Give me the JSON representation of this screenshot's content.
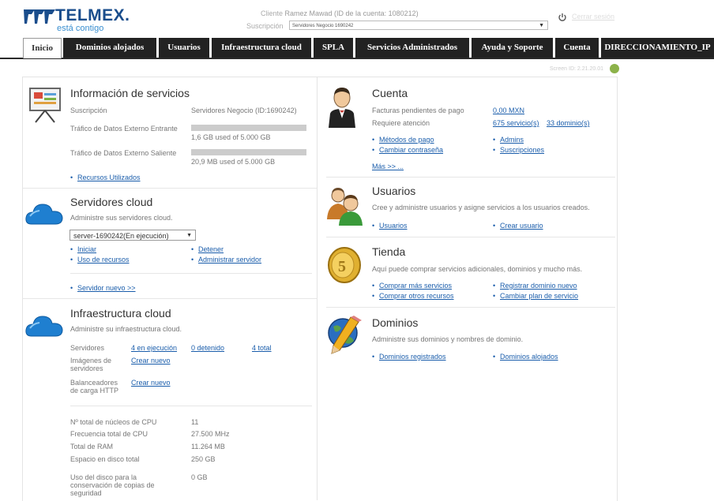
{
  "header": {
    "logo_text": "TELMEX.",
    "logo_tagline": "está contigo",
    "client_label": "Cliente",
    "client_value": "Ramez Mawad (ID de la cuenta: 1080212)",
    "subscription_label": "Suscripción",
    "subscription_value": "Servidores Negocio 1690242",
    "logout_label": "Cerrar sesión"
  },
  "nav": {
    "tabs": [
      {
        "label": "Inicio"
      },
      {
        "label": "Dominios alojados"
      },
      {
        "label": "Usuarios"
      },
      {
        "label": "Infraestructura cloud"
      },
      {
        "label": "SPLA"
      },
      {
        "label": "Servicios Administrados"
      },
      {
        "label": "Ayuda y Soporte"
      },
      {
        "label": "Cuenta"
      },
      {
        "label": "DIRECCIONAMIENTO_IP"
      }
    ]
  },
  "screen_id": "Screen ID: 2.21.20.01",
  "services_info": {
    "title": "Información de servicios",
    "subscription_label": "Suscripción",
    "subscription_value": "Servidores Negocio (ID:1690242)",
    "inbound_label": "Tráfico de Datos Externo Entrante",
    "inbound_value": "1,6 GB used of 5.000 GB",
    "inbound_fraction": 0.0003,
    "outbound_label": "Tráfico de Datos Externo Saliente",
    "outbound_value": "20,9 MB used of 5.000 GB",
    "outbound_fraction": 0.0001,
    "resources_link": "Recursos Utilizados"
  },
  "cloud_servers": {
    "title": "Servidores cloud",
    "description": "Administre sus servidores cloud.",
    "selected_server": "server-1690242(En ejecución)",
    "links": {
      "start": "Iniciar",
      "stop": "Detener",
      "usage": "Uso de recursos",
      "manage": "Administrar servidor",
      "new_server": "Servidor nuevo >>"
    }
  },
  "cloud_infra": {
    "title": "Infraestructura cloud",
    "description": "Administre su infraestructura cloud.",
    "servers_label": "Servidores",
    "running": "4 en ejecución",
    "stopped": "0 detenido",
    "total": "4 total",
    "images_label_1": "Imágenes de",
    "images_label_2": "servidores",
    "balancers_label_1": "Balanceadores",
    "balancers_label_2": "de carga HTTP",
    "create_new": "Crear nuevo",
    "stats": [
      {
        "label": "Nº total de núcleos de CPU",
        "value": "11"
      },
      {
        "label": "Frecuencia total de CPU",
        "value": "27.500 MHz"
      },
      {
        "label": "Total de RAM",
        "value": "11.264 MB"
      },
      {
        "label": "Espacio en disco total",
        "value": "250 GB"
      }
    ],
    "backup_label_1": "Uso del disco para la",
    "backup_label_2": "conservación de copias de",
    "backup_label_3": "seguridad",
    "backup_value": "0 GB"
  },
  "account": {
    "title": "Cuenta",
    "pending_label": "Facturas pendientes de pago",
    "pending_value": "0,00 MXN",
    "attention_label": "Requiere atención",
    "attention_services": "675 servicio(s)",
    "attention_domains": "33 dominio(s)",
    "links": {
      "payment": "Métodos de pago",
      "admins": "Admins",
      "password": "Cambiar contraseña",
      "subscriptions": "Suscripciones"
    },
    "more": "Más >> ..."
  },
  "users": {
    "title": "Usuarios",
    "description": "Cree y administre usuarios y asigne servicios a los usuarios creados.",
    "links": {
      "users": "Usuarios",
      "create": "Crear usuario"
    }
  },
  "store": {
    "title": "Tienda",
    "description": "Aquí puede comprar servicios adicionales, dominios y mucho más.",
    "links": {
      "buy_services": "Comprar más servicios",
      "register_domain": "Registrar dominio nuevo",
      "buy_resources": "Comprar otros recursos",
      "change_plan": "Cambiar plan de servicio"
    }
  },
  "domains": {
    "title": "Dominios",
    "description": "Administre sus dominios y nombres de dominio.",
    "links": {
      "registered": "Dominios registrados",
      "hosted": "Dominios alojados"
    }
  },
  "colors": {
    "nav_bg": "#222222",
    "link": "#1a5dab",
    "brand": "#1a4d8c"
  }
}
